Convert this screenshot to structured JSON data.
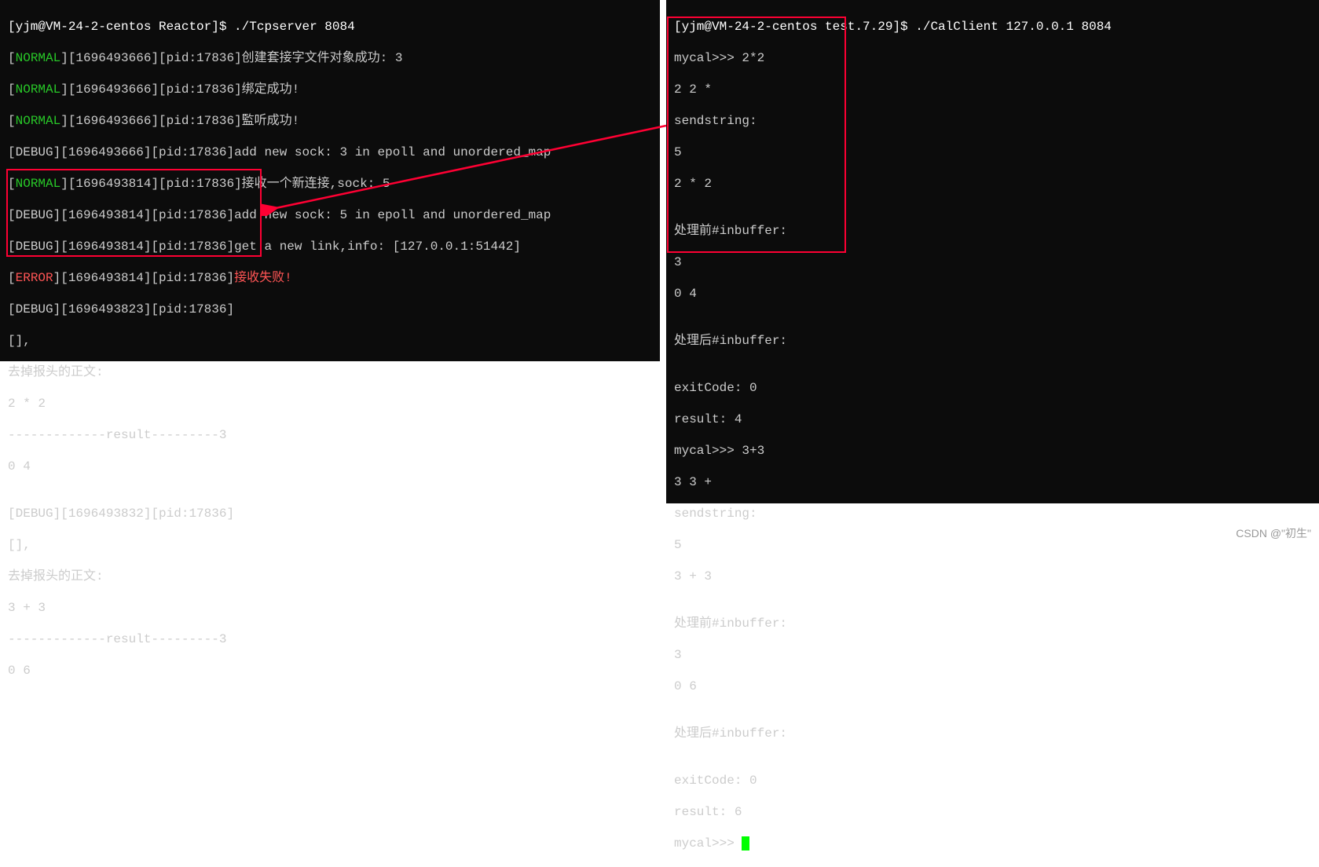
{
  "left_terminal": {
    "prompt": "[yjm@VM-24-2-centos Reactor]$ ./Tcpserver 8084",
    "lines": [
      {
        "lvl": "NORMAL",
        "ts": "1696493666",
        "pid": "17836",
        "msg": "创建套接字文件对象成功: 3"
      },
      {
        "lvl": "NORMAL",
        "ts": "1696493666",
        "pid": "17836",
        "msg": "绑定成功!"
      },
      {
        "lvl": "NORMAL",
        "ts": "1696493666",
        "pid": "17836",
        "msg": "監听成功!"
      },
      {
        "lvl": "DEBUG",
        "ts": "1696493666",
        "pid": "17836",
        "msg": "add new sock: 3 in epoll and unordered_map"
      },
      {
        "lvl": "NORMAL",
        "ts": "1696493814",
        "pid": "17836",
        "msg": "接收一个新连接,sock: 5"
      },
      {
        "lvl": "DEBUG",
        "ts": "1696493814",
        "pid": "17836",
        "msg": "add new sock: 5 in epoll and unordered_map"
      },
      {
        "lvl": "DEBUG",
        "ts": "1696493814",
        "pid": "17836",
        "msg": "get a new link,info: [127.0.0.1:51442]"
      },
      {
        "lvl": "ERROR",
        "ts": "1696493814",
        "pid": "17836",
        "msg": "接收失败!"
      },
      {
        "lvl": "DEBUG",
        "ts": "1696493823",
        "pid": "17836",
        "msg": ""
      }
    ],
    "block1": {
      "l1": "[],",
      "l2": "去掉报头的正文:",
      "l3": "2 * 2",
      "l4": "-------------result---------3",
      "l5": "0 4"
    },
    "blank1": "",
    "debug2": {
      "lvl": "DEBUG",
      "ts": "1696493832",
      "pid": "17836",
      "msg": ""
    },
    "block2": {
      "l1": "[],",
      "l2": "去掉报头的正文:",
      "l3": "3 + 3",
      "l4": "-------------result---------3",
      "l5": "0 6"
    }
  },
  "right_terminal": {
    "prompt": "[yjm@VM-24-2-centos test.7.29]$ ./CalClient 127.0.0.1 8084",
    "session1": {
      "l1": "mycal>>> 2*2",
      "l2": "2 2 *",
      "l3": "sendstring:",
      "l4": "5",
      "l5": "2 * 2",
      "l6": "",
      "l7": "处理前#inbuffer:",
      "l8": "3",
      "l9": "0 4",
      "l10": "",
      "l11": "处理后#inbuffer:",
      "l12": "",
      "l13": "exitCode: 0",
      "l14": "result: 4"
    },
    "session2": {
      "l1": "mycal>>> 3+3",
      "l2": "3 3 +",
      "l3": "sendstring:",
      "l4": "5",
      "l5": "3 + 3",
      "l6": "",
      "l7": "处理前#inbuffer:",
      "l8": "3",
      "l9": "0 6",
      "l10": "",
      "l11": "处理后#inbuffer:",
      "l12": "",
      "l13": "exitCode: 0",
      "l14": "result: 6"
    },
    "prompt2": "mycal>>> "
  },
  "watermark": "CSDN @\"初生\""
}
